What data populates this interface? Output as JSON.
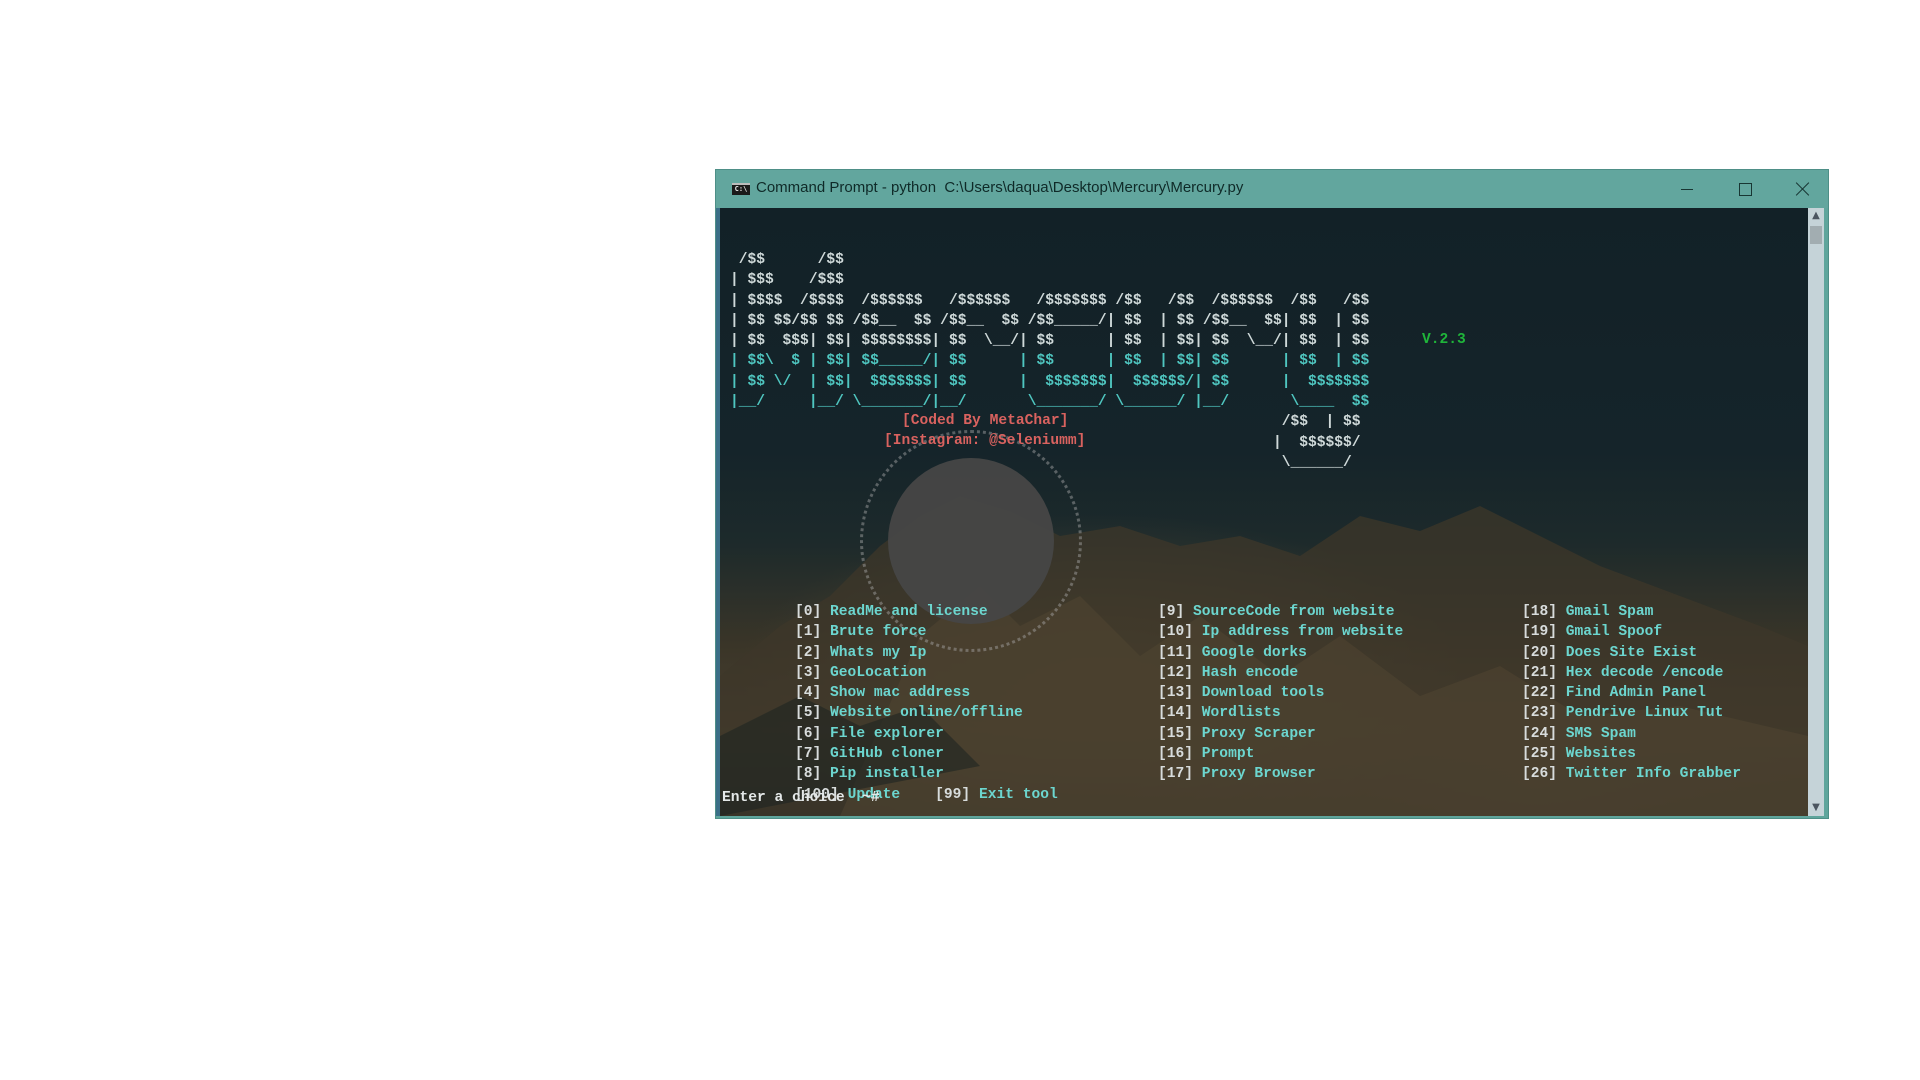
{
  "window": {
    "title": "Command Prompt - python  C:\\Users\\daqua\\Desktop\\Mercury\\Mercury.py",
    "app_icon": "cmd-icon",
    "controls": {
      "minimize": "minimize-icon",
      "maximize": "maximize-icon",
      "close": "close-icon"
    },
    "titlebar_color": "#62a69e"
  },
  "banner": {
    "ascii_lines": [
      [
        {
          "t": " /$$      /$$",
          "c": "w"
        }
      ],
      [
        {
          "t": "| $$$    /$$$",
          "c": "w"
        }
      ],
      [
        {
          "t": "| $$$$  /$$$$  /$$$$$$   /$$$$$$   /$$$$$$$ /$$   /$$  /$$$$$$  /$$   /$$",
          "c": "w"
        }
      ],
      [
        {
          "t": "| $$ $$/$$ $$ /$$__  $$ /$$__  $$ /$$_____/| $$  | $$ /$$__  $$| $$  | $$",
          "c": "w"
        }
      ],
      [
        {
          "t": "| $$  $$$| $$| $$$$$$$$| $$  \\__/| $$      | $$  | $$| $$  \\__/| $$  | $$",
          "c": "w"
        }
      ],
      [
        {
          "t": "| $$\\  $ | $$| $$_____/| $$      | $$      | $$  | $$| $$      | $$  | $$",
          "c": "c"
        }
      ],
      [
        {
          "t": "| $$ \\/  | $$|  $$$$$$$| $$      |  $$$$$$$|  $$$$$$/| $$      |  $$$$$$$",
          "c": "c"
        }
      ],
      [
        {
          "t": "|__/     |__/ \\_______/|__/       \\_______/ \\______/ |__/       \\____  $$",
          "c": "c"
        }
      ],
      [
        {
          "t": "                                                               /$$  | $$",
          "c": "w"
        }
      ],
      [
        {
          "t": "                                                              |  $$$$$$/",
          "c": "w"
        }
      ],
      [
        {
          "t": "                                                               \\______/",
          "c": "w"
        }
      ]
    ],
    "version": "V.2.3",
    "credit": "[Coded By MetaChar]",
    "instagram": "[Instagram: @Seleniumm]",
    "colors": {
      "ascii_white": "#cfd9d9",
      "ascii_cyan": "#4fc6c0",
      "version": "#1fb53a",
      "credit": "#d9625f"
    }
  },
  "menu": {
    "columns": [
      [
        {
          "num": "[0]",
          "label": "ReadMe and license"
        },
        {
          "num": "[1]",
          "label": "Brute force"
        },
        {
          "num": "[2]",
          "label": "Whats my Ip"
        },
        {
          "num": "[3]",
          "label": "GeoLocation"
        },
        {
          "num": "[4]",
          "label": "Show mac address"
        },
        {
          "num": "[5]",
          "label": "Website online/offline"
        },
        {
          "num": "[6]",
          "label": "File explorer"
        },
        {
          "num": "[7]",
          "label": "GitHub cloner"
        },
        {
          "num": "[8]",
          "label": "Pip installer"
        }
      ],
      [
        {
          "num": "[9]",
          "label": "SourceCode from website"
        },
        {
          "num": "[10]",
          "label": "Ip address from website"
        },
        {
          "num": "[11]",
          "label": "Google dorks"
        },
        {
          "num": "[12]",
          "label": "Hash encode"
        },
        {
          "num": "[13]",
          "label": "Download tools"
        },
        {
          "num": "[14]",
          "label": "Wordlists"
        },
        {
          "num": "[15]",
          "label": "Proxy Scraper"
        },
        {
          "num": "[16]",
          "label": "Prompt"
        },
        {
          "num": "[17]",
          "label": "Proxy Browser"
        }
      ],
      [
        {
          "num": "[18]",
          "label": "Gmail Spam"
        },
        {
          "num": "[19]",
          "label": "Gmail Spoof"
        },
        {
          "num": "[20]",
          "label": "Does Site Exist"
        },
        {
          "num": "[21]",
          "label": "Hex decode /encode"
        },
        {
          "num": "[22]",
          "label": "Find Admin Panel"
        },
        {
          "num": "[23]",
          "label": "Pendrive Linux Tut"
        },
        {
          "num": "[24]",
          "label": "SMS Spam"
        },
        {
          "num": "[25]",
          "label": "Websites"
        },
        {
          "num": "[26]",
          "label": "Twitter Info Grabber"
        }
      ]
    ],
    "extra": [
      {
        "num": "[100]",
        "label": "Update"
      },
      {
        "num": "[99]",
        "label": "Exit tool"
      }
    ],
    "colors": {
      "number": "#d8dcdc",
      "label": "#6cd6cf"
    }
  },
  "prompt": {
    "text": "Enter a choice  ~#"
  },
  "scrollbar": {
    "up": "chevron-up-icon",
    "down": "chevron-down-icon",
    "position": 0
  }
}
